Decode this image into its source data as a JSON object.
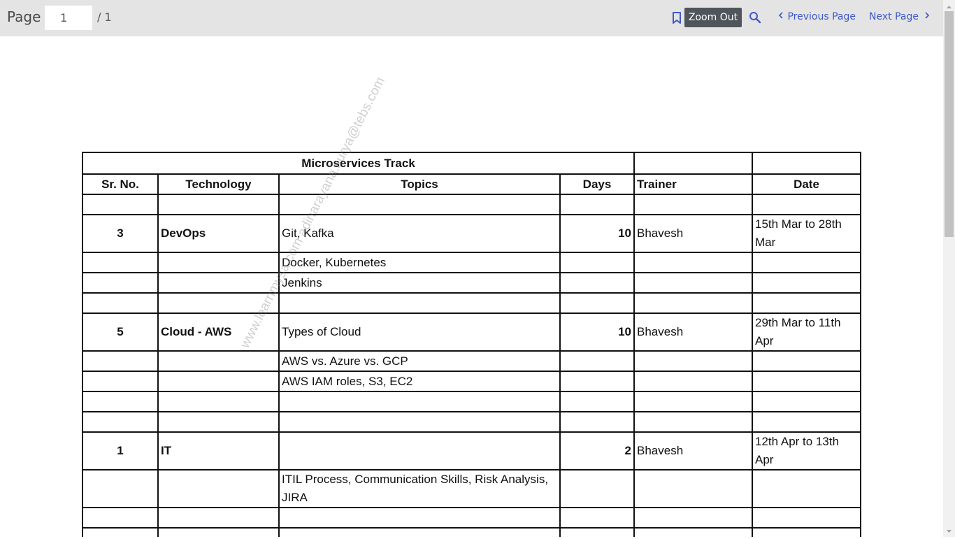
{
  "toolbar": {
    "page_label": "Page",
    "page_value": "1",
    "page_total": "/ 1",
    "zoom_label": "Zoom Out",
    "prev_label": "Previous Page",
    "next_label": "Next Page",
    "icons": [
      "bookmark-icon",
      "search-icon",
      "chevron-left-icon",
      "chevron-right-icon"
    ],
    "accent_color": "#3f58c8"
  },
  "document": {
    "title": "Microservices Track",
    "headers": [
      "Sr. No.",
      "Technology",
      "Topics",
      "Days",
      "Trainer",
      "Date"
    ],
    "watermark": "www.learnmysa.com adinarayana.surya@tebs.com",
    "rows": [
      {
        "sr": "",
        "tech": "",
        "topic": "",
        "days": "",
        "trainer": "",
        "date": ""
      },
      {
        "sr": "3",
        "tech": "DevOps",
        "topic": "Git, Kafka",
        "days": "10",
        "trainer": "Bhavesh",
        "date": "15th Mar to 28th Mar"
      },
      {
        "sr": "",
        "tech": "",
        "topic": "Docker, Kubernetes",
        "days": "",
        "trainer": "",
        "date": ""
      },
      {
        "sr": "",
        "tech": "",
        "topic": "Jenkins",
        "days": "",
        "trainer": "",
        "date": ""
      },
      {
        "sr": "",
        "tech": "",
        "topic": "",
        "days": "",
        "trainer": "",
        "date": ""
      },
      {
        "sr": "5",
        "tech": "Cloud - AWS",
        "topic": "Types of Cloud",
        "days": "10",
        "trainer": "Bhavesh",
        "date": "29th Mar to 11th Apr"
      },
      {
        "sr": "",
        "tech": "",
        "topic": "AWS vs. Azure vs. GCP",
        "days": "",
        "trainer": "",
        "date": ""
      },
      {
        "sr": "",
        "tech": "",
        "topic": "AWS IAM roles, S3, EC2",
        "days": "",
        "trainer": "",
        "date": ""
      },
      {
        "sr": "",
        "tech": "",
        "topic": "",
        "days": "",
        "trainer": "",
        "date": ""
      },
      {
        "sr": "",
        "tech": "",
        "topic": "",
        "days": "",
        "trainer": "",
        "date": ""
      },
      {
        "sr": "1",
        "tech": "IT",
        "topic": "",
        "days": "2",
        "trainer": "Bhavesh",
        "date": "12th Apr to 13th Apr"
      },
      {
        "sr": "",
        "tech": "",
        "topic": "ITIL Process, Communication Skills, Risk Analysis, JIRA",
        "days": "",
        "trainer": "",
        "date": ""
      },
      {
        "sr": "",
        "tech": "",
        "topic": "",
        "days": "",
        "trainer": "",
        "date": ""
      },
      {
        "sr": "",
        "tech": "",
        "topic": "",
        "days": "",
        "trainer": "",
        "date": ""
      }
    ]
  }
}
